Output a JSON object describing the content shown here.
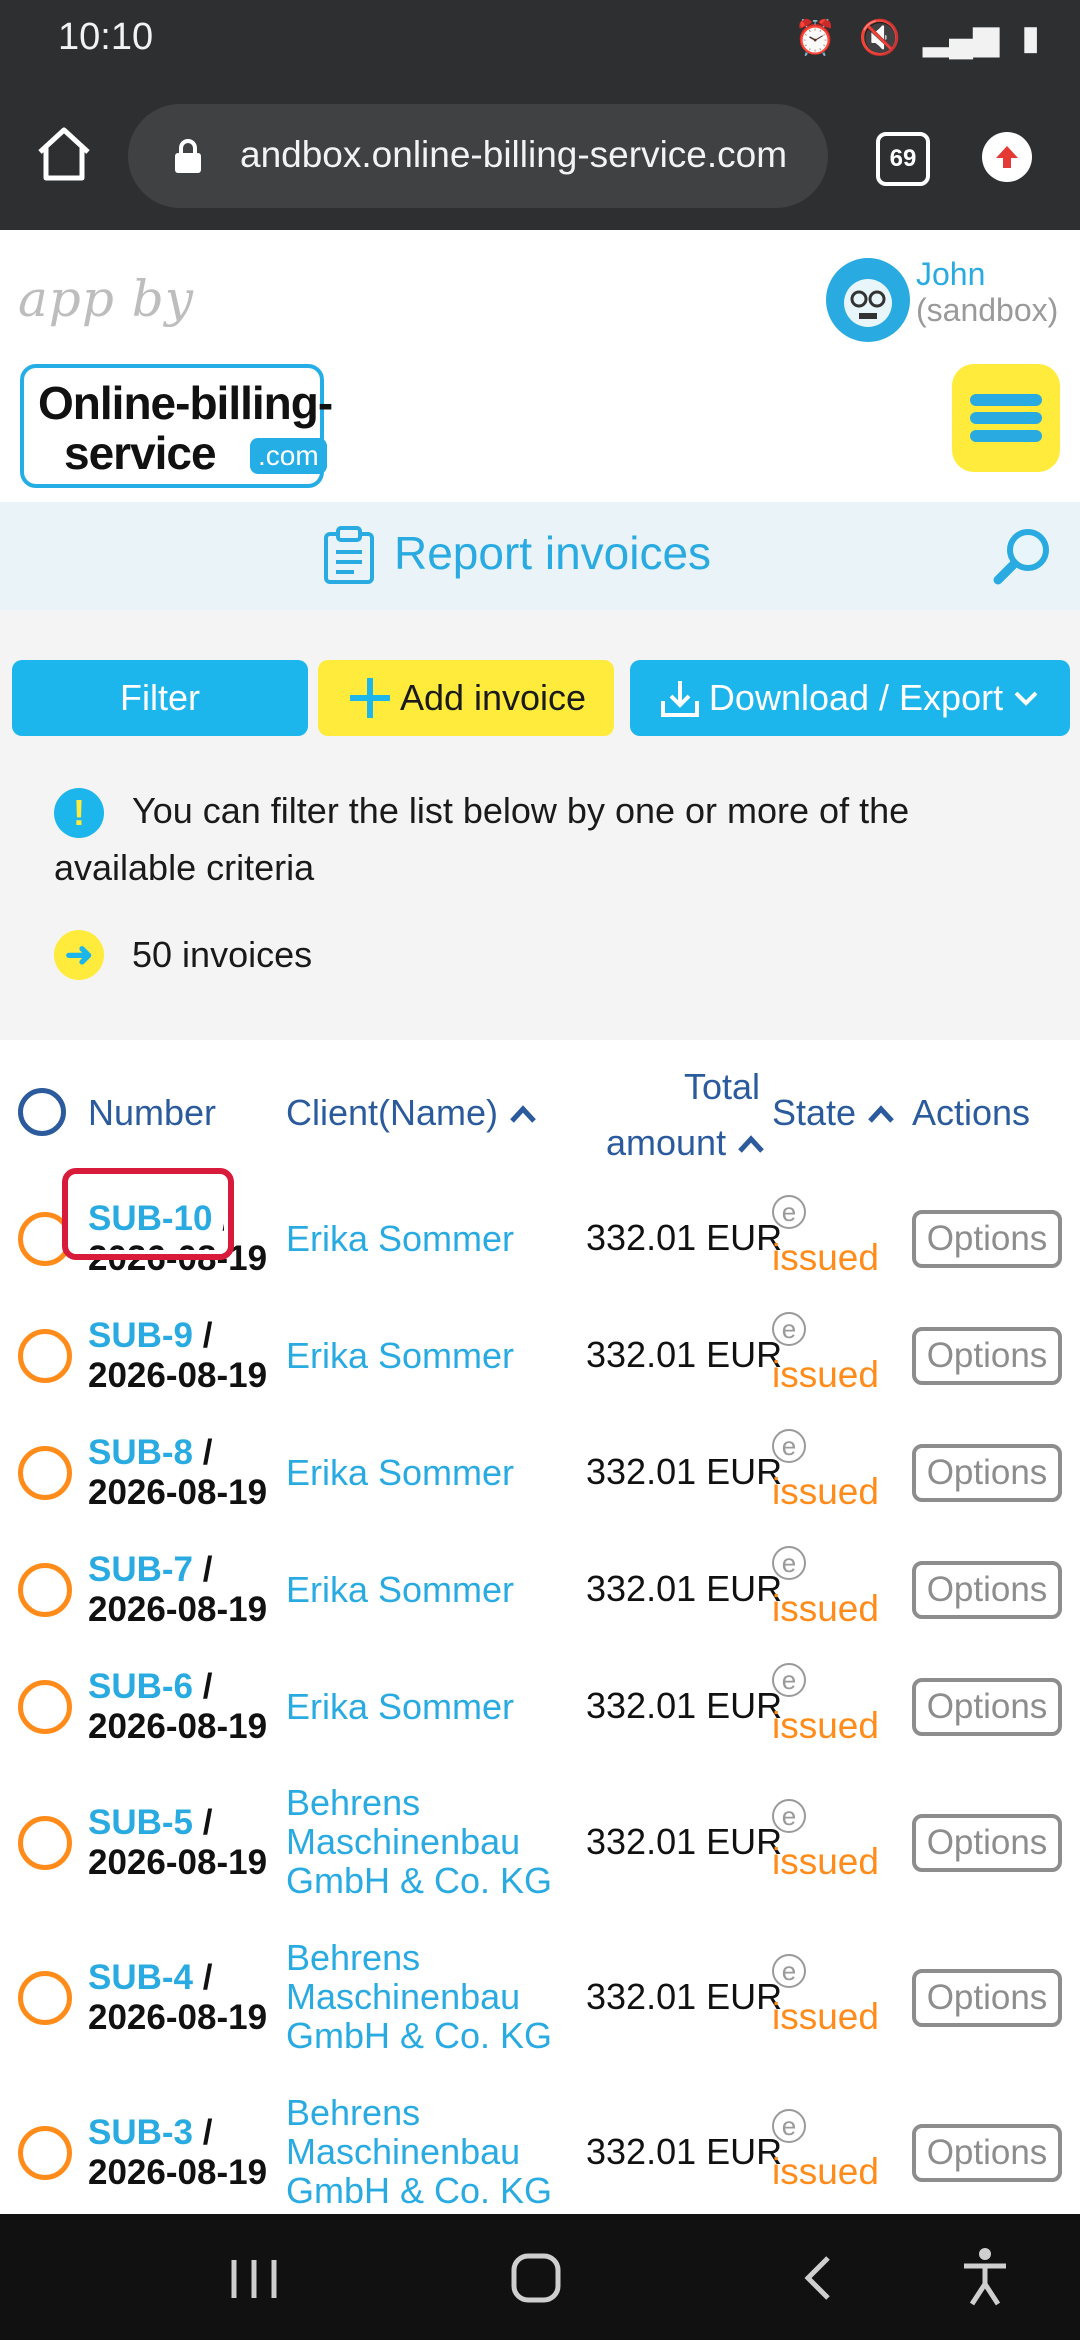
{
  "status_bar": {
    "time": "10:10"
  },
  "browser": {
    "url": "andbox.online-billing-service.com",
    "tab_count": "69"
  },
  "header": {
    "app_by": "app by",
    "logo": {
      "line1": "Online-billing-",
      "line2": "service",
      "com": ".com"
    },
    "user": {
      "name": "John",
      "sub": "(sandbox)"
    }
  },
  "page": {
    "title": "Report invoices"
  },
  "toolbar": {
    "filter_label": "Filter",
    "add_label": "Add invoice",
    "export_label": "Download / Export"
  },
  "info": {
    "message": "You can filter the list below by one or more of the available criteria",
    "count": "50 invoices"
  },
  "table": {
    "headers": {
      "number": "Number",
      "client": "Client(Name)",
      "total_line1": "Total",
      "total_line2": "amount",
      "state": "State",
      "actions": "Actions"
    },
    "rows": [
      {
        "id": "SUB-10",
        "date": "2026-08-19",
        "client": "Erika Sommer",
        "amount": "332.01 EUR",
        "state": "issued",
        "action": "Options"
      },
      {
        "id": "SUB-9",
        "date": "2026-08-19",
        "client": "Erika Sommer",
        "amount": "332.01 EUR",
        "state": "issued",
        "action": "Options"
      },
      {
        "id": "SUB-8",
        "date": "2026-08-19",
        "client": "Erika Sommer",
        "amount": "332.01 EUR",
        "state": "issued",
        "action": "Options"
      },
      {
        "id": "SUB-7",
        "date": "2026-08-19",
        "client": "Erika Sommer",
        "amount": "332.01 EUR",
        "state": "issued",
        "action": "Options"
      },
      {
        "id": "SUB-6",
        "date": "2026-08-19",
        "client": "Erika Sommer",
        "amount": "332.01 EUR",
        "state": "issued",
        "action": "Options"
      },
      {
        "id": "SUB-5",
        "date": "2026-08-19",
        "client": "Behrens Maschinenbau GmbH & Co. KG",
        "amount": "332.01 EUR",
        "state": "issued",
        "action": "Options"
      },
      {
        "id": "SUB-4",
        "date": "2026-08-19",
        "client": "Behrens Maschinenbau GmbH & Co. KG",
        "amount": "332.01 EUR",
        "state": "issued",
        "action": "Options"
      },
      {
        "id": "SUB-3",
        "date": "2026-08-19",
        "client": "Behrens Maschinenbau GmbH & Co. KG",
        "amount": "332.01 EUR",
        "state": "issued",
        "action": "Options"
      }
    ]
  },
  "colors": {
    "accent": "#29abe2",
    "yellow": "#ffeb3b",
    "orange": "#ff8c1a",
    "highlight": "#d81b3b"
  },
  "icons": [
    "home-icon",
    "lock-icon",
    "tabs-icon",
    "update-icon",
    "menu-icon",
    "clipboard-icon",
    "search-icon",
    "plus-icon",
    "download-icon",
    "chevron-down-icon",
    "info-icon",
    "arrow-right-icon",
    "chevron-up-icon",
    "recents-icon",
    "home-nav-icon",
    "back-icon",
    "accessibility-icon"
  ]
}
